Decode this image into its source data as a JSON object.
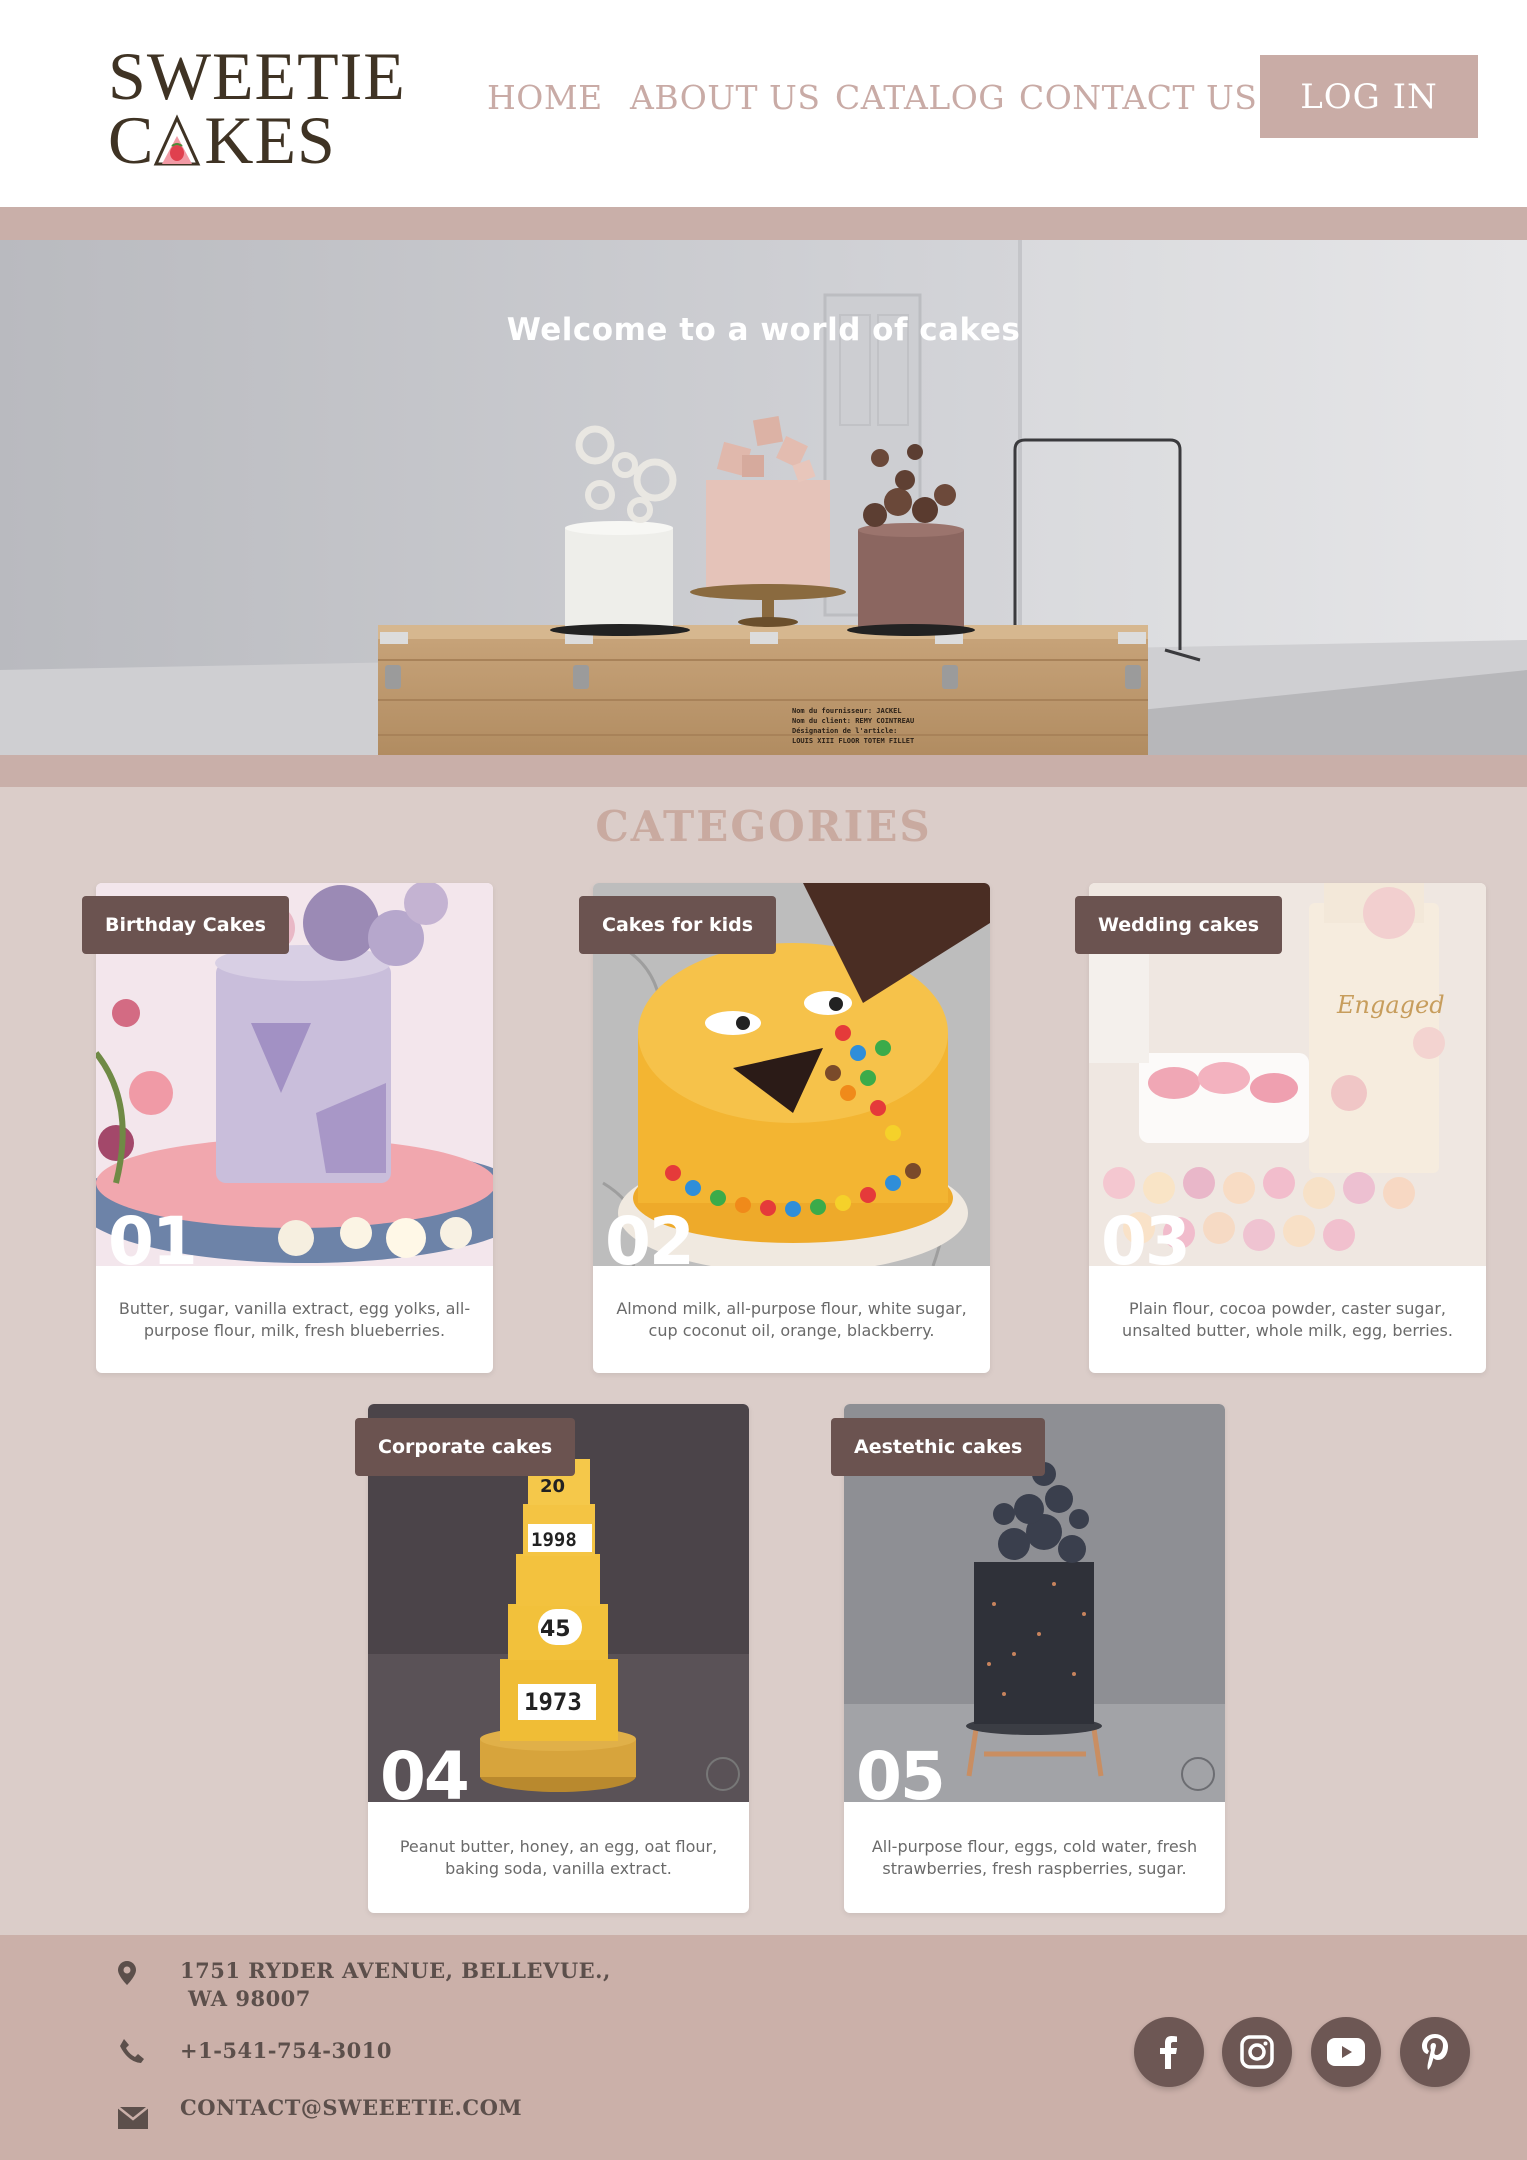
{
  "brand": {
    "logo_line1": "SWEETIE",
    "logo_line2_before": "C",
    "logo_line2_after": "KES"
  },
  "nav": {
    "items": [
      {
        "label": "HOME"
      },
      {
        "label": "ABOUT US"
      },
      {
        "label": "CATALOG"
      },
      {
        "label": "CONTACT US"
      }
    ],
    "login_label": "LOG IN"
  },
  "hero": {
    "title": "Welcome to a world of cakes",
    "crate_text": [
      "Nom du fournisseur: JACKEL",
      "Nom du client: REMY COINTREAU",
      "Désignation de l'article:",
      "LOUIS XIII FLOOR TOTEM FILLET"
    ]
  },
  "categories": {
    "title": "CATEGORIES",
    "cards": [
      {
        "tag": "Birthday Cakes",
        "number": "01",
        "description": "Butter, sugar, vanilla extract, egg yolks, all-purpose flour, milk, fresh blueberries."
      },
      {
        "tag": "Cakes for kids",
        "number": "02",
        "description": "Almond milk, all-purpose flour, white sugar, cup coconut oil, orange, blackberry."
      },
      {
        "tag": "Wedding cakes",
        "number": "03",
        "description": "Plain flour, cocoa powder, caster sugar, unsalted butter, whole milk, egg, berries."
      },
      {
        "tag": "Corporate cakes",
        "number": "04",
        "description": "Peanut butter, honey, an egg, oat flour, baking soda, vanilla extract."
      },
      {
        "tag": "Aestethic cakes",
        "number": "05",
        "description": "All-purpose flour, eggs, cold water, fresh strawberries, fresh raspberries, sugar."
      }
    ],
    "image_text": {
      "engaged": "Engaged",
      "year_1998": "1998",
      "year_1973": "1973",
      "num_45": "45",
      "num_20": "20"
    }
  },
  "footer": {
    "address_line1": "1751 RYDER AVENUE, BELLEVUE.,",
    "address_line2": "WA 98007",
    "phone": "+1-541-754-3010",
    "email": "CONTACT@SWEEETIE.COM",
    "social": [
      {
        "icon": "facebook-icon"
      },
      {
        "icon": "instagram-icon"
      },
      {
        "icon": "youtube-icon"
      },
      {
        "icon": "pinterest-icon"
      }
    ]
  },
  "colors": {
    "accent": "#c9aca6",
    "tag_bg": "#6b5350",
    "logo": "#3f3324",
    "section_bg": "#dbcdc9",
    "footer_bg": "#cbb0a9"
  }
}
